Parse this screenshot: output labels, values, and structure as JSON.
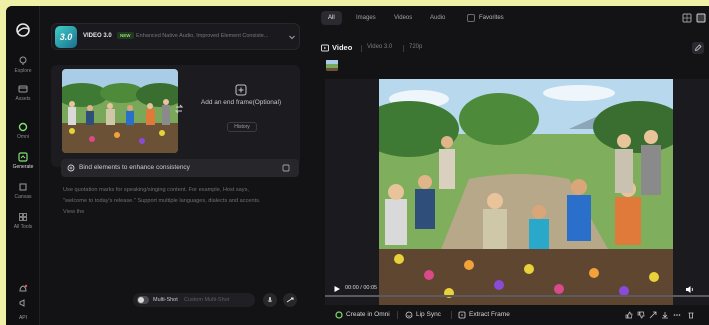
{
  "rail": {
    "items": [
      {
        "label": "Explore",
        "icon": "compass-icon"
      },
      {
        "label": "Assets",
        "icon": "folder-icon"
      },
      {
        "label": "Omni",
        "icon": "omni-icon"
      },
      {
        "label": "Generate",
        "icon": "generate-icon"
      },
      {
        "label": "Canvas",
        "icon": "canvas-icon"
      },
      {
        "label": "All Tools",
        "icon": "grid-icon"
      }
    ],
    "api_label": "API"
  },
  "model": {
    "badge": "3.0",
    "name": "VIDEO 3.0",
    "new_label": "NEW",
    "description": "Enhanced Native Audio, Improved Element Consiste..."
  },
  "frames": {
    "end_frame_label": "Add an end frame(Optional)",
    "history_label": "History"
  },
  "bind": {
    "label": "Bind elements to enhance consistency"
  },
  "prompt": {
    "lines": [
      "Use quotation marks for speaking/singing content. For example, Host says,",
      "\"welcome to today's release.\" Support multiple languages, dialects and accents.",
      "View the"
    ]
  },
  "shot": {
    "label": "Multi-Shot",
    "sub": "Custom Multi-Shot"
  },
  "filters": {
    "tabs": [
      "All",
      "Images",
      "Videos",
      "Audio"
    ],
    "favorites_label": "Favorites"
  },
  "video_header": {
    "title": "Video",
    "model": "Video 3.0",
    "resolution": "720p"
  },
  "player": {
    "time": "00:00 / 00:05",
    "progress": 0.0
  },
  "actions": {
    "create": "Create in Omni",
    "lip_sync": "Lip Sync",
    "extract": "Extract Frame"
  },
  "colors": {
    "accent_green": "#7fe06f",
    "background": "#131316"
  }
}
